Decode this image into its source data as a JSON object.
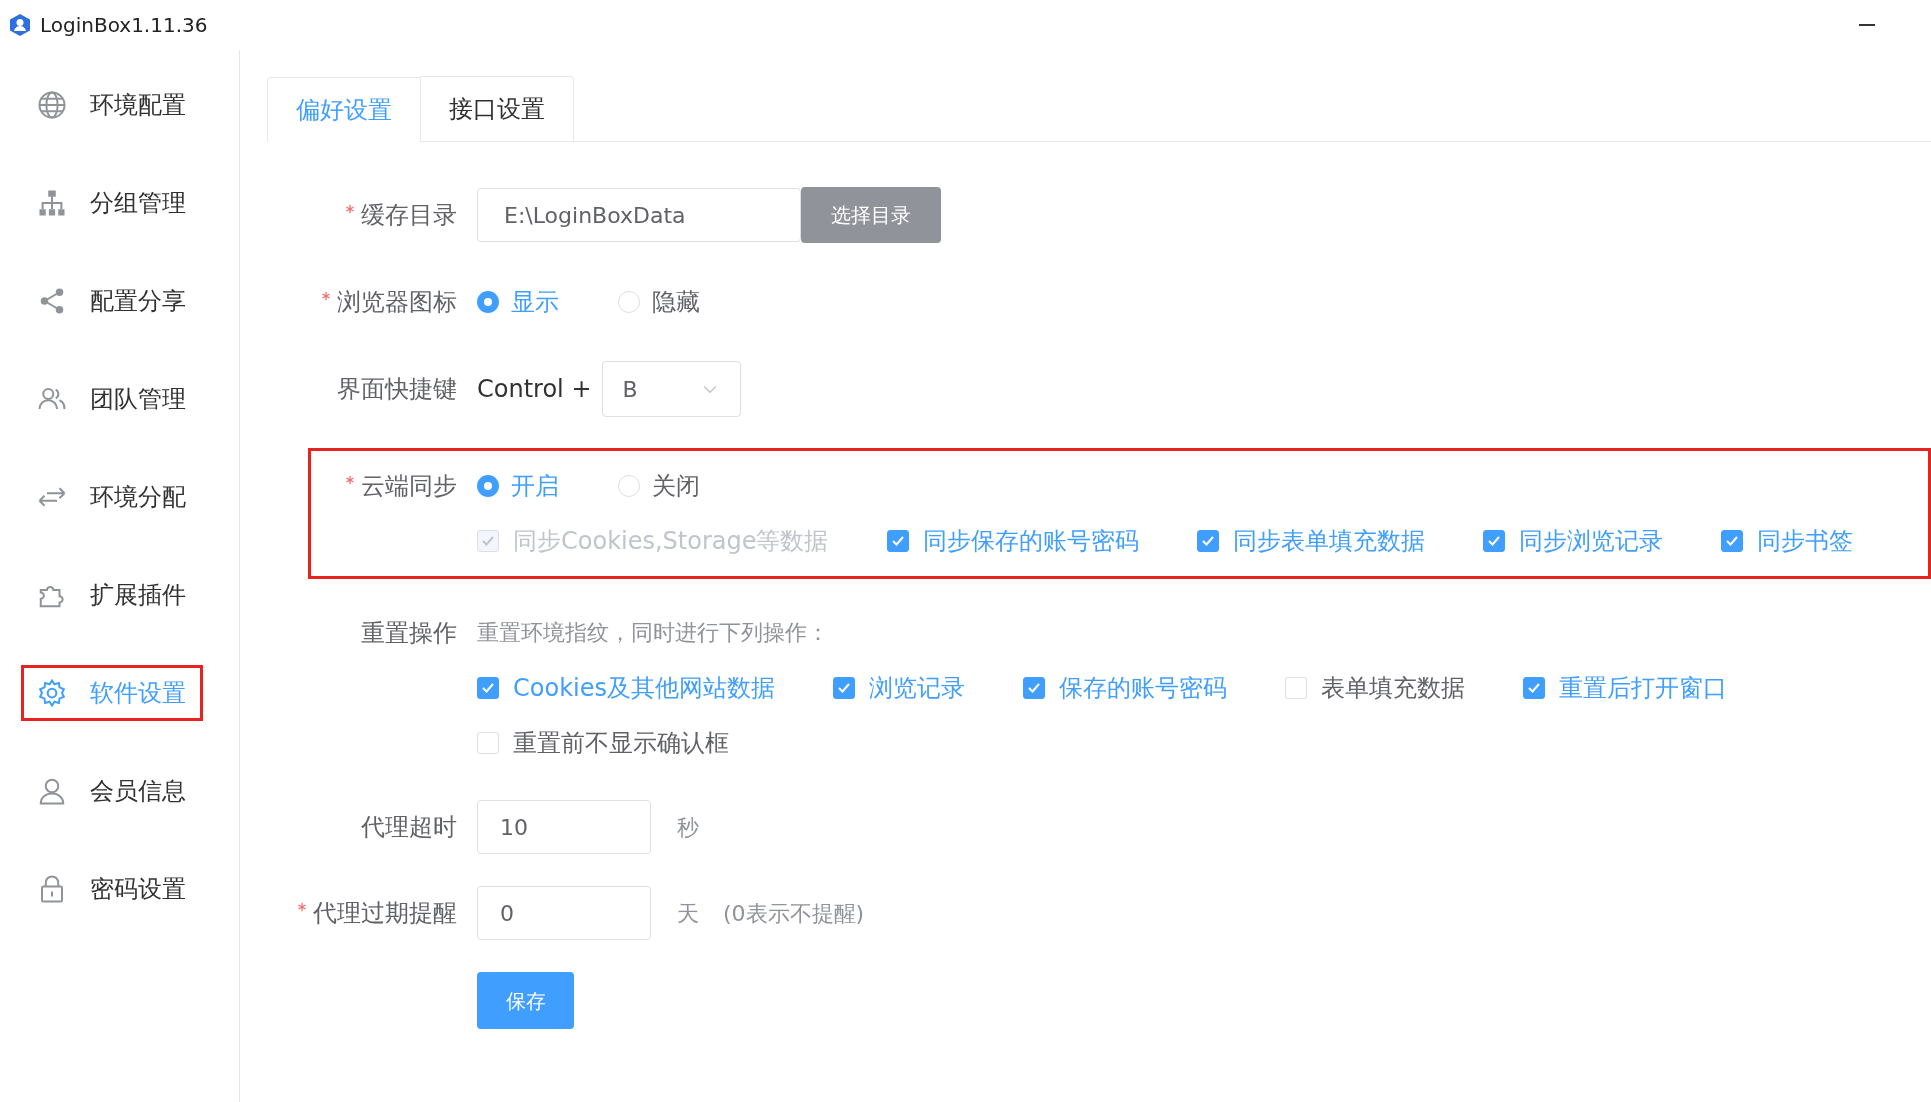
{
  "window": {
    "title": "LoginBox1.11.36"
  },
  "sidebar": {
    "items": [
      {
        "label": "环境配置",
        "selected": false,
        "highlighted": false
      },
      {
        "label": "分组管理",
        "selected": false,
        "highlighted": false
      },
      {
        "label": "配置分享",
        "selected": false,
        "highlighted": false
      },
      {
        "label": "团队管理",
        "selected": false,
        "highlighted": false
      },
      {
        "label": "环境分配",
        "selected": false,
        "highlighted": false
      },
      {
        "label": "扩展插件",
        "selected": false,
        "highlighted": false
      },
      {
        "label": "软件设置",
        "selected": true,
        "highlighted": true
      },
      {
        "label": "会员信息",
        "selected": false,
        "highlighted": false
      },
      {
        "label": "密码设置",
        "selected": false,
        "highlighted": false
      }
    ]
  },
  "tabs": [
    {
      "label": "偏好设置",
      "selected": true
    },
    {
      "label": "接口设置",
      "selected": false
    }
  ],
  "form": {
    "rows": [
      {
        "kind": "directory",
        "label": "缓存目录",
        "required": true,
        "value": "E:\\LoginBoxData",
        "button": "选择目录"
      },
      {
        "kind": "radio",
        "label": "浏览器图标",
        "required": true,
        "options": [
          {
            "label": "显示",
            "selected": true
          },
          {
            "label": "隐藏",
            "selected": false
          }
        ]
      },
      {
        "kind": "shortcut",
        "label": "界面快捷键",
        "required": false,
        "prefix": "Control +",
        "value": "B"
      },
      {
        "kind": "radio",
        "label": "云端同步",
        "required": true,
        "highlighted": true,
        "options": [
          {
            "label": "开启",
            "selected": true
          },
          {
            "label": "关闭",
            "selected": false
          }
        ],
        "checkboxes": [
          {
            "label": "同步Cookies,Storage等数据",
            "checked": true,
            "disabled": true
          },
          {
            "label": "同步保存的账号密码",
            "checked": true,
            "disabled": false
          },
          {
            "label": "同步表单填充数据",
            "checked": true,
            "disabled": false
          },
          {
            "label": "同步浏览记录",
            "checked": true,
            "disabled": false
          },
          {
            "label": "同步书签",
            "checked": true,
            "disabled": false
          }
        ]
      },
      {
        "kind": "checks",
        "label": "重置操作",
        "required": false,
        "hint": "重置环境指纹，同时进行下列操作：",
        "checkboxes": [
          {
            "label": "Cookies及其他网站数据",
            "checked": true,
            "disabled": false
          },
          {
            "label": "浏览记录",
            "checked": true,
            "disabled": false
          },
          {
            "label": "保存的账号密码",
            "checked": true,
            "disabled": false
          },
          {
            "label": "表单填充数据",
            "checked": false,
            "disabled": false
          },
          {
            "label": "重置后打开窗口",
            "checked": true,
            "disabled": false
          },
          {
            "label": "重置前不显示确认框",
            "checked": false,
            "disabled": false
          }
        ]
      },
      {
        "kind": "number",
        "label": "代理超时",
        "required": false,
        "value": "10",
        "unit": "秒"
      },
      {
        "kind": "number",
        "label": "代理过期提醒",
        "required": true,
        "value": "0",
        "unit": "天",
        "note": "(0表示不提醒)"
      }
    ],
    "submit": "保存"
  }
}
